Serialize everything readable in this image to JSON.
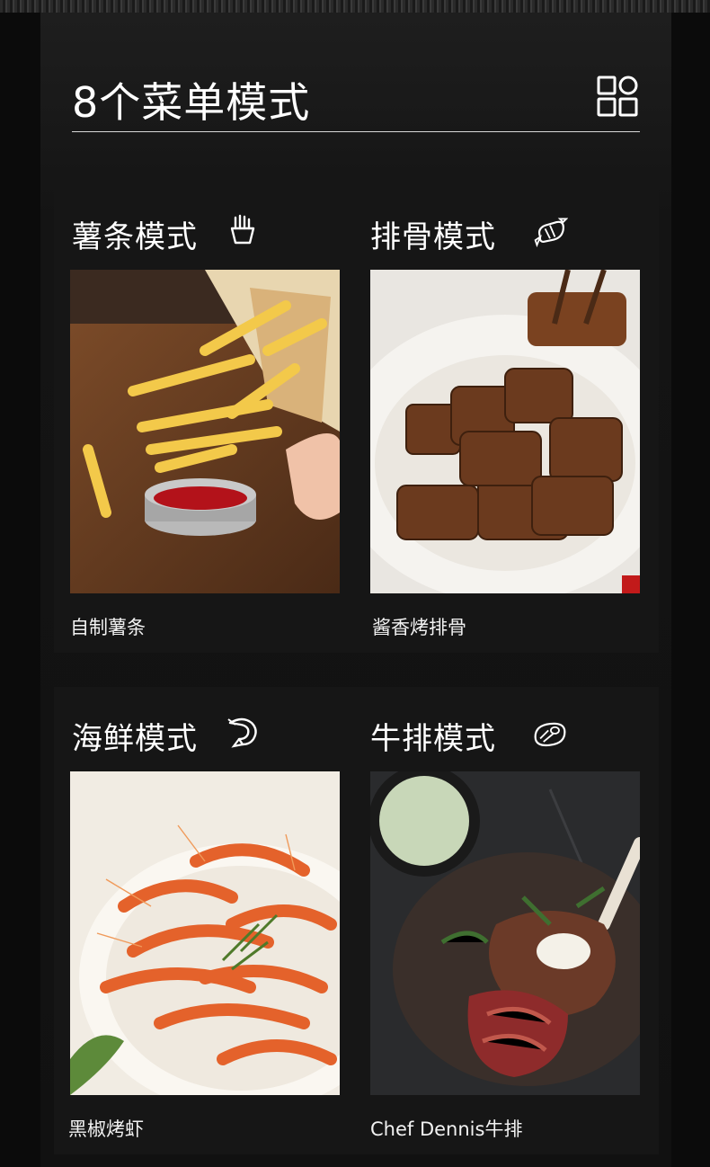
{
  "header": {
    "title": "8个菜单模式",
    "grid_icon": "grid-layout-icon"
  },
  "modes": [
    {
      "title": "薯条模式",
      "icon": "fries-icon",
      "caption": "自制薯条",
      "photo": "french-fries-with-ketchup-photo"
    },
    {
      "title": "排骨模式",
      "icon": "candy-ribs-icon",
      "caption": "酱香烤排骨",
      "photo": "roasted-pork-ribs-photo"
    },
    {
      "title": "海鲜模式",
      "icon": "shrimp-icon",
      "caption": "黑椒烤虾",
      "photo": "pepper-roasted-shrimp-photo"
    },
    {
      "title": "牛排模式",
      "icon": "steak-icon",
      "caption": "Chef Dennis牛排",
      "photo": "tomahawk-steak-photo"
    }
  ],
  "colors": {
    "background": "#0b0b0b",
    "card": "#161616",
    "text": "#ffffff",
    "rule": "#d8d8d8"
  }
}
